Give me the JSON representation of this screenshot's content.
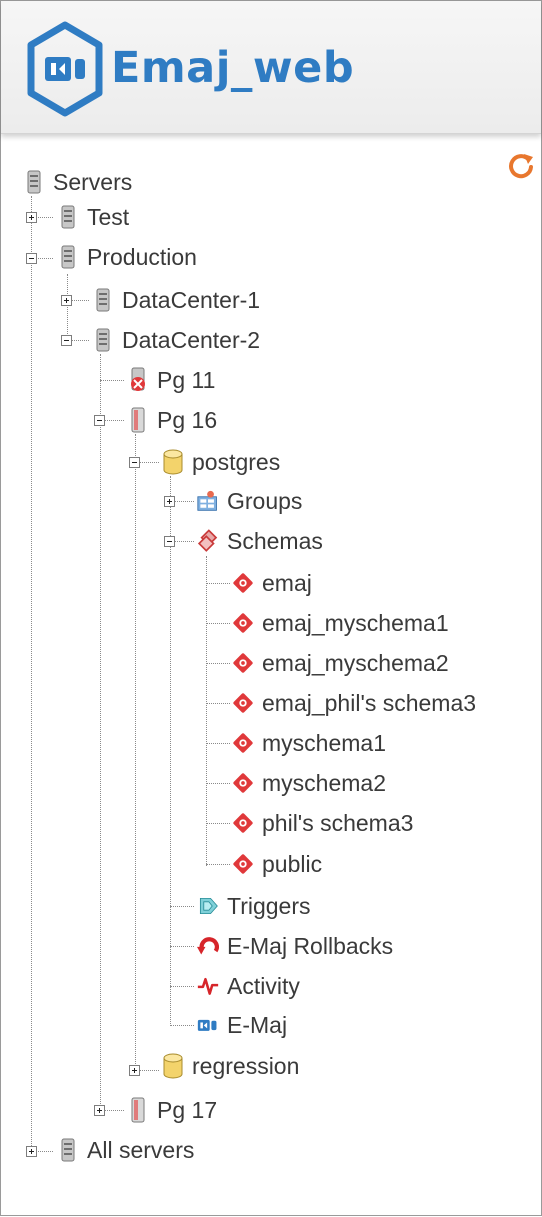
{
  "app": {
    "logo_text": "Emaj_web"
  },
  "tree": {
    "servers": "Servers",
    "test": "Test",
    "production": "Production",
    "datacenter1": "DataCenter-1",
    "datacenter2": "DataCenter-2",
    "pg11": "Pg 11",
    "pg16": "Pg 16",
    "postgres": "postgres",
    "groups": "Groups",
    "schemas": "Schemas",
    "schema_items": [
      "emaj",
      "emaj_myschema1",
      "emaj_myschema2",
      "emaj_phil's schema3",
      "myschema1",
      "myschema2",
      "phil's schema3",
      "public"
    ],
    "triggers": "Triggers",
    "rollbacks": "E-Maj Rollbacks",
    "activity": "Activity",
    "emaj": "E-Maj",
    "regression": "regression",
    "pg17": "Pg 17",
    "all_servers": "All servers"
  },
  "colors": {
    "brand_blue": "#2f7cc3",
    "schema_red": "#e0383a",
    "accent_orange": "#e8772e"
  }
}
